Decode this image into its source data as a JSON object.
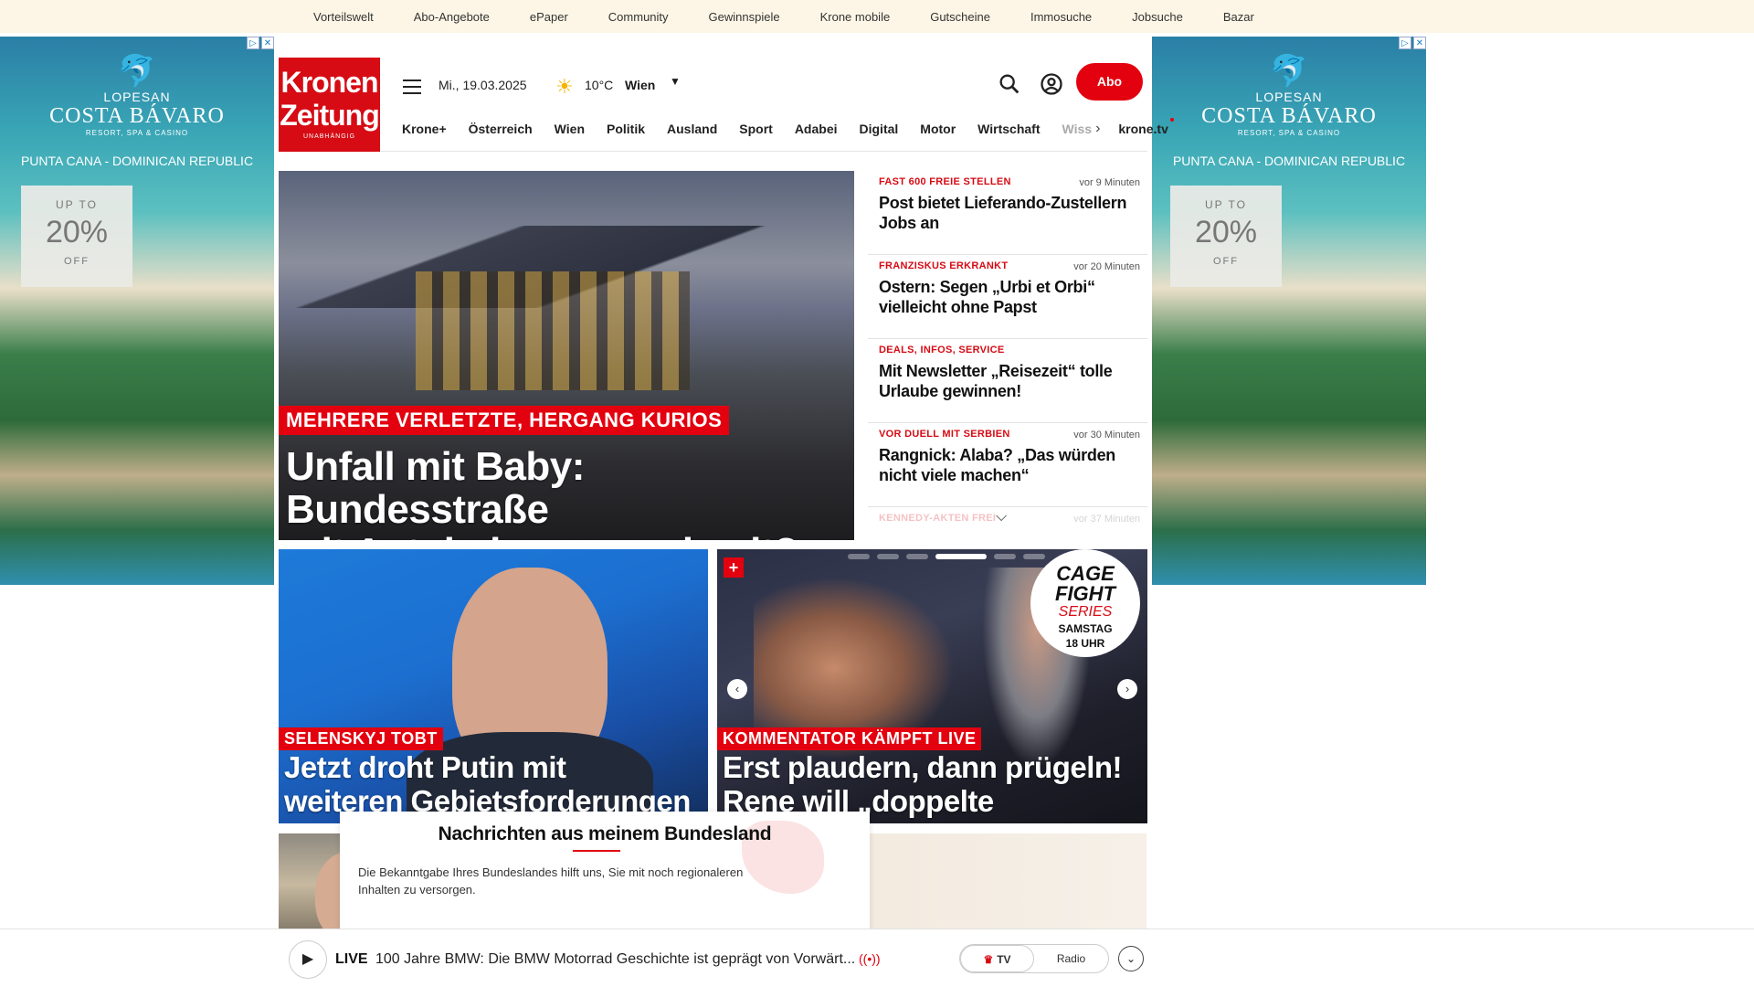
{
  "topbar": {
    "links": [
      "Vorteilswelt",
      "Abo-Angebote",
      "ePaper",
      "Community",
      "Gewinnspiele",
      "Krone mobile",
      "Gutscheine",
      "Immosuche",
      "Jobsuche",
      "Bazar"
    ]
  },
  "ads": {
    "brand_line1": "LOPESAN",
    "brand_line2": "COSTA BÁVARO",
    "brand_line3": "RESORT, SPA & CASINO",
    "tagline": "PUNTA CANA - DOMINICAN REPUBLIC",
    "up_to": "UP TO",
    "percent": "20%",
    "off": "OFF"
  },
  "header": {
    "logo_line1": "Kronen",
    "logo_line2": "Zeitung",
    "logo_sub": "UNABHÄNGIG",
    "date": "Mi., 19.03.2025",
    "temperature": "10°C",
    "city": "Wien",
    "abo_label": "Abo"
  },
  "nav": {
    "items": [
      "Krone+",
      "Österreich",
      "Wien",
      "Politik",
      "Ausland",
      "Sport",
      "Adabei",
      "Digital",
      "Motor",
      "Wirtschaft"
    ],
    "faded": "Wiss",
    "tv": "krone.tv"
  },
  "hero": {
    "kicker": "MEHRERE VERLETZTE, HERGANG KURIOS",
    "headline_line1": "Unfall mit Baby: Bundesstraße",
    "headline_line2": "mit Autobahn verwechselt?"
  },
  "side_news": [
    {
      "kicker": "FAST 600 FREIE STELLEN",
      "time": "vor 9 Minuten",
      "title": "Post bietet Lieferando-Zustellern Jobs an"
    },
    {
      "kicker": "FRANZISKUS ERKRANKT",
      "time": "vor 20 Minuten",
      "title": "Ostern: Segen „Urbi et Orbi“ vielleicht ohne Papst"
    },
    {
      "kicker": "DEALS, INFOS, SERVICE",
      "time": "",
      "title": "Mit Newsletter „Reisezeit“ tolle Urlaube gewinnen!"
    },
    {
      "kicker": "VOR DUELL MIT SERBIEN",
      "time": "vor 30 Minuten",
      "title": "Rangnick: Alaba? „Das würden nicht viele machen“"
    },
    {
      "kicker": "KENNEDY-AKTEN FREI",
      "time": "vor 37 Minuten",
      "title": ""
    }
  ],
  "card1": {
    "kicker": "SELENSKYJ TOBT",
    "headline_line1": "Jetzt droht Putin mit",
    "headline_line2": "weiteren Gebietsforderungen"
  },
  "card2": {
    "kicker": "KOMMENTATOR KÄMPFT LIVE",
    "headline_line1": "Erst plaudern, dann prügeln!",
    "headline_line2": "Rene will „doppelte Dröhnung“",
    "badge_line1": "CAGE",
    "badge_line2": "FIGHT",
    "badge_line3": "SERIES",
    "badge_line4": "SAMSTAG",
    "badge_line5": "18 UHR",
    "slides_total": 6,
    "slide_active": 4
  },
  "bundesland": {
    "heading": "Nachrichten aus meinem Bundesland",
    "text": "Die Bekanntgabe Ihres Bundeslandes hilft uns, Sie mit noch regionaleren Inhalten zu versorgen."
  },
  "player": {
    "live": "LIVE",
    "title": "100 Jahre BMW: Die BMW Motorrad Geschichte ist geprägt von Vorwärt...",
    "tv": "TV",
    "radio": "Radio"
  }
}
